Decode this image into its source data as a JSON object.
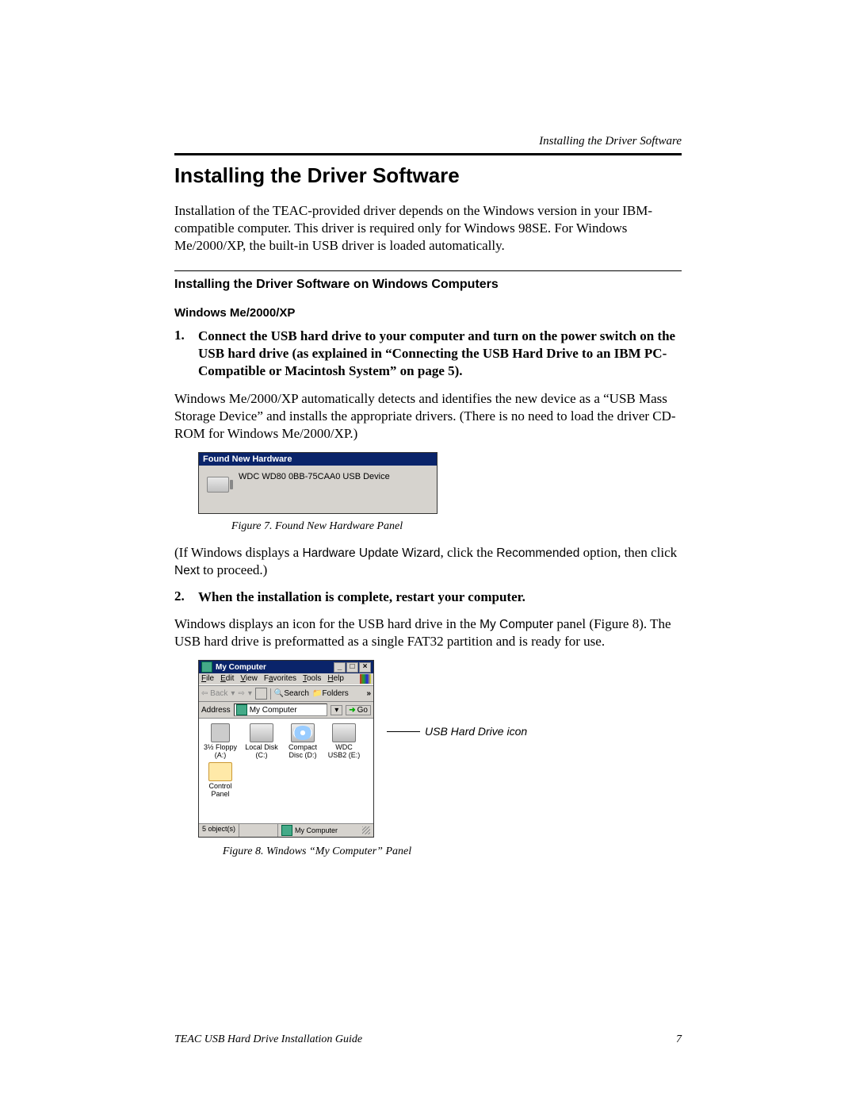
{
  "header": {
    "running": "Installing the Driver Software"
  },
  "h1": "Installing the Driver Software",
  "intro": "Installation of the TEAC-provided driver depends on the Windows version in your IBM-compatible computer. This driver is required only for Windows 98SE. For Windows Me/2000/XP, the built-in USB driver is loaded automatically.",
  "h2": "Installing the Driver Software on Windows Computers",
  "h3": "Windows Me/2000/XP",
  "step1": {
    "num": "1.",
    "bold": "Connect the USB hard drive to your computer and turn on the power switch on the USB hard drive (as explained in “Connecting the USB Hard Drive to an IBM PC-Compatible or Macintosh System” on page 5).",
    "body": "Windows Me/2000/XP automatically detects and identifies the new device as a “USB Mass Storage Device” and installs the appropriate drivers. (There is no need to load the driver CD-ROM for Windows Me/2000/XP.)"
  },
  "fig7": {
    "title": "Found New Hardware",
    "device": "WDC WD80 0BB-75CAA0 USB Device",
    "caption": "Figure 7. Found New Hardware Panel"
  },
  "after_fig7": {
    "pre": "(If Windows displays a ",
    "t1": "Hardware Update Wizard",
    "mid1": ", click the ",
    "t2": "Recommended",
    "mid2": " option, then click ",
    "t3": "Next",
    "post": " to proceed.)"
  },
  "step2": {
    "num": "2.",
    "bold": "When the installation is complete, restart your computer.",
    "body_pre": "Windows displays an icon for the USB hard drive in the ",
    "body_t1": "My Computer",
    "body_post": " panel (Figure 8). The USB hard drive is preformatted as a single FAT32 partition and is ready for use."
  },
  "fig8": {
    "title": "My Computer",
    "menus": {
      "file": "File",
      "edit": "Edit",
      "view": "View",
      "fav": "Favorites",
      "tools": "Tools",
      "help": "Help"
    },
    "toolbar": {
      "back": "Back",
      "search": "Search",
      "folders": "Folders"
    },
    "address_label": "Address",
    "address_value": "My Computer",
    "go": "Go",
    "items": [
      {
        "label": "3½ Floppy (A:)"
      },
      {
        "label": "Local Disk (C:)"
      },
      {
        "label": "Compact Disc (D:)"
      },
      {
        "label": "WDC USB2 (E:)"
      },
      {
        "label": "Control Panel"
      }
    ],
    "status_left": "5 object(s)",
    "status_right": "My Computer",
    "callout": "USB Hard Drive icon",
    "caption": "Figure 8. Windows “My Computer” Panel"
  },
  "footer": {
    "left": "TEAC USB Hard Drive Installation Guide",
    "right": "7"
  }
}
